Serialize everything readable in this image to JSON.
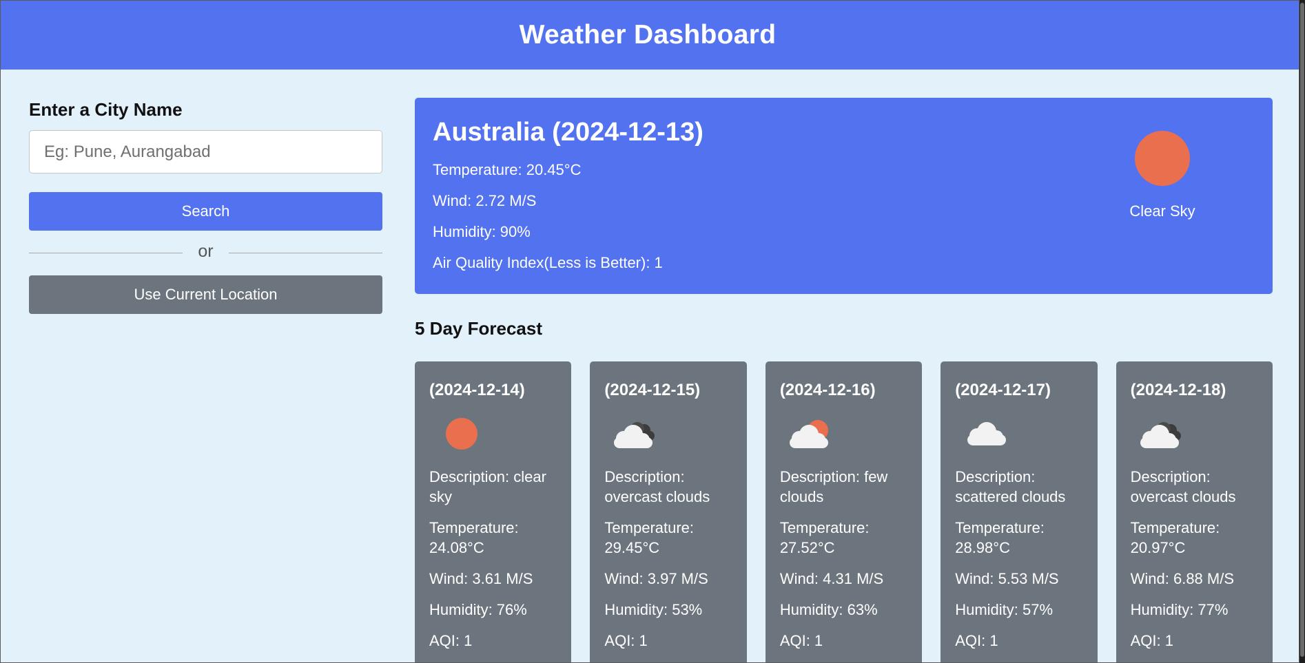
{
  "header": {
    "title": "Weather Dashboard"
  },
  "search": {
    "heading": "Enter a City Name",
    "placeholder": "Eg: Pune, Aurangabad",
    "button_label": "Search",
    "separator_text": "or",
    "location_button_label": "Use Current Location"
  },
  "current": {
    "title": "Australia (2024-12-13)",
    "temperature": "Temperature: 20.45°C",
    "wind": "Wind: 2.72 M/S",
    "humidity": "Humidity: 90%",
    "aqi": "Air Quality Index(Less is Better): 1",
    "icon": "clear-sky-icon",
    "description": "Clear Sky"
  },
  "forecast": {
    "title": "5 Day Forecast",
    "days": [
      {
        "date": "(2024-12-14)",
        "icon": "clear-sky-icon",
        "description": "Description: clear sky",
        "temperature": "Temperature: 24.08°C",
        "wind": "Wind: 3.61 M/S",
        "humidity": "Humidity: 76%",
        "aqi": "AQI: 1"
      },
      {
        "date": "(2024-12-15)",
        "icon": "overcast-clouds-icon",
        "description": "Description: overcast clouds",
        "temperature": "Temperature: 29.45°C",
        "wind": "Wind: 3.97 M/S",
        "humidity": "Humidity: 53%",
        "aqi": "AQI: 1"
      },
      {
        "date": "(2024-12-16)",
        "icon": "few-clouds-icon",
        "description": "Description: few clouds",
        "temperature": "Temperature: 27.52°C",
        "wind": "Wind: 4.31 M/S",
        "humidity": "Humidity: 63%",
        "aqi": "AQI: 1"
      },
      {
        "date": "(2024-12-17)",
        "icon": "scattered-clouds-icon",
        "description": "Description: scattered clouds",
        "temperature": "Temperature: 28.98°C",
        "wind": "Wind: 5.53 M/S",
        "humidity": "Humidity: 57%",
        "aqi": "AQI: 1"
      },
      {
        "date": "(2024-12-18)",
        "icon": "overcast-clouds-icon",
        "description": "Description: overcast clouds",
        "temperature": "Temperature: 20.97°C",
        "wind": "Wind: 6.88 M/S",
        "humidity": "Humidity: 77%",
        "aqi": "AQI: 1"
      }
    ]
  },
  "colors": {
    "primary": "#5372f0",
    "secondary": "#6c757d",
    "background": "#e3f1fb",
    "sun": "#ea6f4f"
  }
}
